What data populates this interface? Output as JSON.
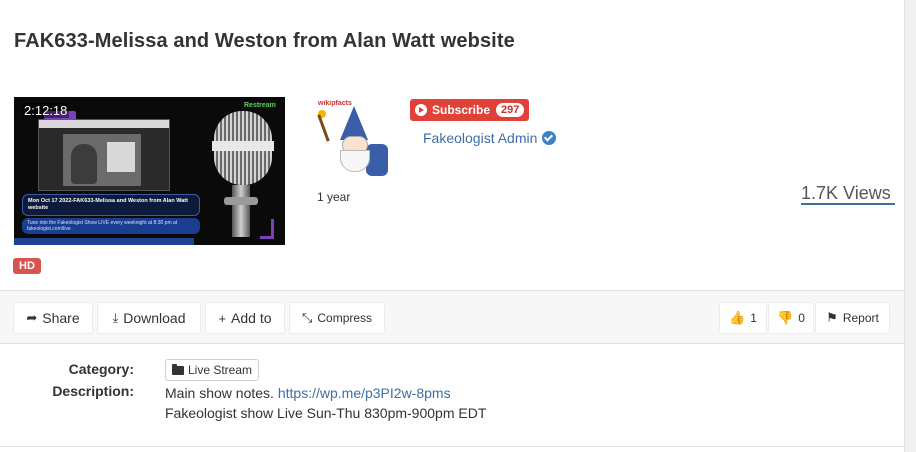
{
  "video": {
    "title": "FAK633-Melissa and Weston from Alan Watt website",
    "duration": "2:12:18",
    "quality_badge": "HD",
    "age": "1 year",
    "views": "1.7K Views",
    "thumbnail": {
      "restream_label": "Restream",
      "caption_line": "Mon Oct 17 2022-FAK633-Melissa and Weston from Alan Watt website",
      "caption_sub": "Tune into the Fakeologist Show LIVE every weeknight at 8:30 pm at fakeologist.com/live"
    }
  },
  "channel": {
    "name": "Fakeologist Admin",
    "verified": true,
    "subscribe_label": "Subscribe",
    "subscriber_count": "297",
    "avatar_watermark": "wikipfacts"
  },
  "toolbar": {
    "share": "Share",
    "download": "Download",
    "add_to": "Add to",
    "compress": "Compress",
    "likes": "1",
    "dislikes": "0",
    "report": "Report"
  },
  "info": {
    "category_label": "Category:",
    "category_value": "Live Stream",
    "description_label": "Description:",
    "description_text": "Main show notes.",
    "description_link": "https://wp.me/p3PI2w-8pms",
    "description_line2": "Fakeologist show Live Sun-Thu 830pm-900pm EDT"
  },
  "colors": {
    "subscribe": "#e0423a",
    "link": "#3d6fa3",
    "hd_badge": "#d9534f"
  }
}
